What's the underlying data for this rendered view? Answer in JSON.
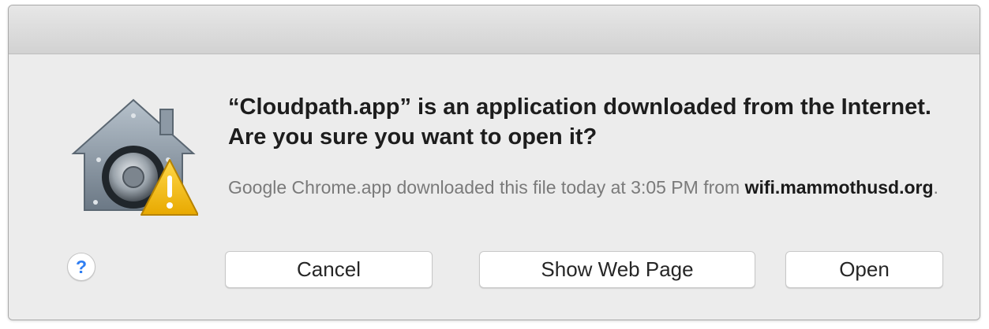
{
  "dialog": {
    "headline": "“Cloudpath.app” is an application downloaded from the Internet. Are you sure you want to open it?",
    "info_prefix": "Google Chrome.app downloaded this file today at 3:05 PM from ",
    "info_host": "wifi.mammothusd.org",
    "info_suffix": ".",
    "icon": "gatekeeper-security-icon",
    "warning_icon": "warning-triangle-icon"
  },
  "buttons": {
    "help_label": "?",
    "cancel_label": "Cancel",
    "show_web_page_label": "Show Web Page",
    "open_label": "Open"
  },
  "colors": {
    "dialog_background": "#ececec",
    "help_accent": "#2f7ef2",
    "warning_yellow": "#f2c200"
  }
}
